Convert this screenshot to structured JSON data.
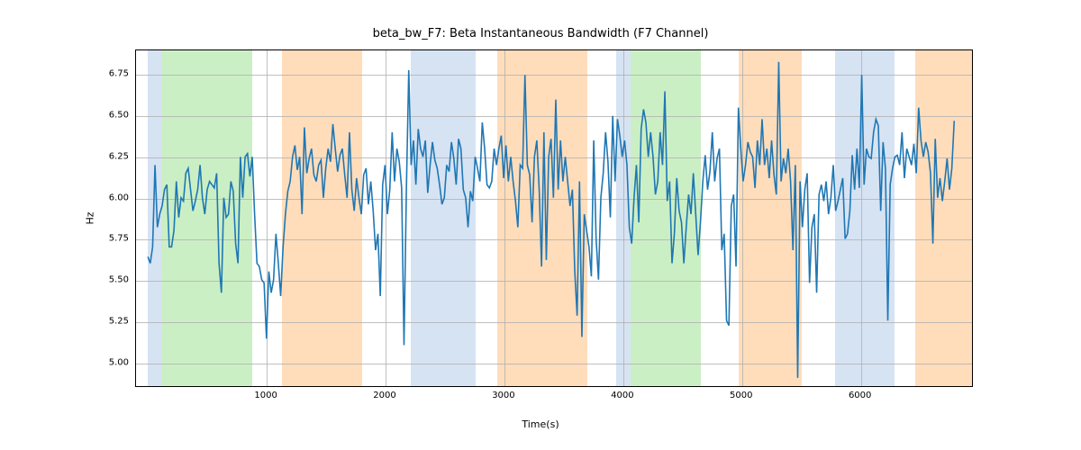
{
  "chart_data": {
    "type": "line",
    "title": "beta_bw_F7: Beta Instantaneous Bandwidth (F7 Channel)",
    "xlabel": "Time(s)",
    "ylabel": "Hz",
    "xlim": [
      -100,
      6950
    ],
    "ylim": [
      4.85,
      6.9
    ],
    "x_ticks": [
      1000,
      2000,
      3000,
      4000,
      5000,
      6000
    ],
    "y_ticks": [
      5.0,
      5.25,
      5.5,
      5.75,
      6.0,
      6.25,
      6.5,
      6.75
    ],
    "shaded_regions": [
      {
        "start": 0,
        "end": 110,
        "color": "blue"
      },
      {
        "start": 110,
        "end": 880,
        "color": "green"
      },
      {
        "start": 1130,
        "end": 1800,
        "color": "orange"
      },
      {
        "start": 2210,
        "end": 2760,
        "color": "blue"
      },
      {
        "start": 2940,
        "end": 3700,
        "color": "orange"
      },
      {
        "start": 3940,
        "end": 4060,
        "color": "blue"
      },
      {
        "start": 4060,
        "end": 4650,
        "color": "green"
      },
      {
        "start": 4970,
        "end": 5500,
        "color": "orange"
      },
      {
        "start": 5780,
        "end": 6280,
        "color": "blue"
      },
      {
        "start": 6460,
        "end": 6950,
        "color": "orange"
      }
    ],
    "x": [
      0,
      20,
      40,
      60,
      80,
      100,
      120,
      140,
      160,
      180,
      200,
      220,
      240,
      260,
      280,
      300,
      320,
      340,
      360,
      380,
      400,
      420,
      440,
      460,
      480,
      500,
      520,
      540,
      560,
      580,
      600,
      620,
      640,
      660,
      680,
      700,
      720,
      740,
      760,
      780,
      800,
      820,
      840,
      860,
      880,
      900,
      920,
      940,
      960,
      980,
      1000,
      1020,
      1040,
      1060,
      1080,
      1100,
      1120,
      1140,
      1160,
      1180,
      1200,
      1220,
      1240,
      1260,
      1280,
      1300,
      1320,
      1340,
      1360,
      1380,
      1400,
      1420,
      1440,
      1460,
      1480,
      1500,
      1520,
      1540,
      1560,
      1580,
      1600,
      1620,
      1640,
      1660,
      1680,
      1700,
      1720,
      1740,
      1760,
      1780,
      1800,
      1820,
      1840,
      1860,
      1880,
      1900,
      1920,
      1940,
      1960,
      1980,
      2000,
      2020,
      2040,
      2060,
      2080,
      2100,
      2120,
      2140,
      2160,
      2180,
      2200,
      2220,
      2240,
      2260,
      2280,
      2300,
      2320,
      2340,
      2360,
      2380,
      2400,
      2420,
      2440,
      2460,
      2480,
      2500,
      2520,
      2540,
      2560,
      2580,
      2600,
      2620,
      2640,
      2660,
      2680,
      2700,
      2720,
      2740,
      2760,
      2780,
      2800,
      2820,
      2840,
      2860,
      2880,
      2900,
      2920,
      2940,
      2960,
      2980,
      3000,
      3020,
      3040,
      3060,
      3080,
      3100,
      3120,
      3140,
      3160,
      3180,
      3200,
      3220,
      3240,
      3260,
      3280,
      3300,
      3320,
      3340,
      3360,
      3380,
      3400,
      3420,
      3440,
      3460,
      3480,
      3500,
      3520,
      3540,
      3560,
      3580,
      3600,
      3620,
      3640,
      3660,
      3680,
      3700,
      3720,
      3740,
      3760,
      3780,
      3800,
      3820,
      3840,
      3860,
      3880,
      3900,
      3920,
      3940,
      3960,
      3980,
      4000,
      4020,
      4040,
      4060,
      4080,
      4100,
      4120,
      4140,
      4160,
      4180,
      4200,
      4220,
      4240,
      4260,
      4280,
      4300,
      4320,
      4340,
      4360,
      4380,
      4400,
      4420,
      4440,
      4460,
      4480,
      4500,
      4520,
      4540,
      4560,
      4580,
      4600,
      4620,
      4640,
      4660,
      4680,
      4700,
      4720,
      4740,
      4760,
      4780,
      4800,
      4820,
      4840,
      4860,
      4880,
      4900,
      4920,
      4940,
      4960,
      4980,
      5000,
      5020,
      5040,
      5060,
      5080,
      5100,
      5120,
      5140,
      5160,
      5180,
      5200,
      5220,
      5240,
      5260,
      5280,
      5300,
      5320,
      5340,
      5360,
      5380,
      5400,
      5420,
      5440,
      5460,
      5480,
      5500,
      5520,
      5540,
      5560,
      5580,
      5600,
      5620,
      5640,
      5660,
      5680,
      5700,
      5720,
      5740,
      5760,
      5780,
      5800,
      5820,
      5840,
      5860,
      5880,
      5900,
      5920,
      5940,
      5960,
      5980,
      6000,
      6020,
      6040,
      6060,
      6080,
      6100,
      6120,
      6140,
      6160,
      6180,
      6200,
      6220,
      6240,
      6260,
      6280,
      6300,
      6320,
      6340,
      6360,
      6380,
      6400,
      6420,
      6440,
      6460,
      6480,
      6500,
      6520,
      6540,
      6560,
      6580,
      6600,
      6620,
      6640,
      6660,
      6680,
      6700,
      6720,
      6740,
      6760,
      6780,
      6800
    ],
    "values": [
      5.64,
      5.6,
      5.7,
      6.2,
      5.82,
      5.9,
      5.95,
      6.05,
      6.08,
      5.7,
      5.7,
      5.8,
      6.1,
      5.88,
      6.0,
      5.98,
      6.15,
      6.18,
      6.05,
      5.92,
      5.98,
      6.05,
      6.2,
      6.0,
      5.9,
      6.05,
      6.1,
      6.08,
      6.06,
      6.15,
      5.6,
      5.42,
      6.0,
      5.88,
      5.9,
      6.1,
      6.04,
      5.72,
      5.6,
      6.25,
      6.0,
      6.25,
      6.27,
      6.13,
      6.25,
      5.9,
      5.6,
      5.58,
      5.5,
      5.48,
      5.14,
      5.55,
      5.42,
      5.5,
      5.78,
      5.6,
      5.4,
      5.7,
      5.9,
      6.04,
      6.1,
      6.25,
      6.32,
      6.17,
      6.25,
      5.9,
      6.43,
      6.15,
      6.24,
      6.3,
      6.14,
      6.1,
      6.2,
      6.23,
      6.0,
      6.18,
      6.3,
      6.22,
      6.45,
      6.3,
      6.16,
      6.26,
      6.3,
      6.14,
      6.0,
      6.4,
      6.05,
      5.92,
      6.12,
      6.0,
      5.9,
      6.14,
      6.18,
      5.96,
      6.1,
      5.92,
      5.68,
      5.78,
      5.4,
      6.08,
      6.2,
      5.9,
      6.05,
      6.4,
      6.1,
      6.3,
      6.22,
      6.06,
      5.1,
      6.05,
      6.78,
      6.2,
      6.35,
      6.08,
      6.42,
      6.3,
      6.25,
      6.35,
      6.03,
      6.2,
      6.34,
      6.23,
      6.18,
      6.08,
      5.96,
      6.0,
      6.2,
      6.16,
      6.34,
      6.24,
      6.08,
      6.36,
      6.3,
      6.05,
      6.0,
      5.82,
      6.04,
      5.98,
      6.25,
      6.18,
      6.1,
      6.46,
      6.3,
      6.08,
      6.06,
      6.1,
      6.3,
      6.2,
      6.3,
      6.38,
      6.12,
      6.32,
      6.1,
      6.25,
      6.1,
      5.98,
      5.82,
      6.2,
      6.18,
      6.75,
      6.2,
      6.14,
      5.85,
      6.25,
      6.35,
      6.05,
      5.58,
      6.4,
      5.62,
      6.25,
      6.36,
      6.0,
      6.6,
      6.05,
      6.35,
      6.1,
      6.25,
      6.1,
      5.95,
      6.05,
      5.55,
      5.28,
      6.1,
      5.15,
      5.9,
      5.8,
      5.7,
      5.52,
      6.35,
      5.75,
      5.5,
      6.0,
      6.15,
      6.4,
      6.22,
      5.88,
      6.5,
      6.1,
      6.48,
      6.38,
      6.25,
      6.35,
      6.2,
      5.82,
      5.72,
      6.0,
      6.2,
      5.85,
      6.42,
      6.54,
      6.46,
      6.25,
      6.4,
      6.25,
      6.02,
      6.1,
      6.4,
      6.2,
      6.65,
      5.98,
      6.1,
      5.6,
      5.78,
      6.12,
      5.92,
      5.85,
      5.6,
      5.82,
      6.02,
      5.9,
      6.15,
      5.9,
      5.65,
      5.85,
      6.1,
      6.26,
      6.05,
      6.16,
      6.4,
      6.1,
      6.24,
      6.3,
      5.68,
      5.78,
      5.25,
      5.22,
      5.95,
      6.02,
      5.58,
      6.55,
      6.3,
      6.1,
      6.2,
      6.34,
      6.28,
      6.25,
      6.06,
      6.35,
      6.2,
      6.48,
      6.2,
      6.3,
      6.12,
      6.35,
      6.14,
      6.02,
      6.83,
      6.1,
      6.24,
      6.15,
      6.3,
      6.1,
      5.68,
      6.2,
      4.9,
      6.1,
      5.82,
      6.05,
      6.15,
      5.48,
      5.82,
      5.9,
      5.42,
      6.02,
      6.08,
      5.98,
      6.1,
      5.9,
      6.0,
      6.2,
      5.92,
      5.98,
      6.05,
      6.12,
      5.75,
      5.78,
      5.92,
      6.26,
      6.05,
      6.3,
      6.06,
      6.75,
      6.08,
      6.3,
      6.25,
      6.24,
      6.4,
      6.48,
      6.44,
      5.92,
      6.34,
      6.18,
      5.25,
      6.08,
      6.18,
      6.25,
      6.26,
      6.2,
      6.4,
      6.12,
      6.3,
      6.25,
      6.2,
      6.33,
      6.15,
      6.55,
      6.35,
      6.25,
      6.34,
      6.28,
      6.15,
      5.72,
      6.36,
      6.0,
      6.12,
      5.98,
      6.1,
      6.24,
      6.05,
      6.18,
      6.47
    ]
  }
}
